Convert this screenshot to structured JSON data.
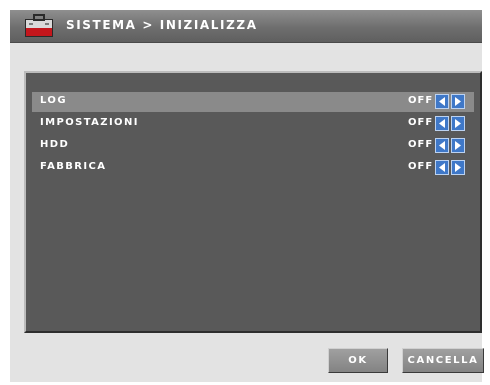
{
  "window": {
    "title": "SISTEMA > INIZIALIZZA"
  },
  "settings": {
    "rows": [
      {
        "label": "LOG",
        "value": "OFF"
      },
      {
        "label": "IMPOSTAZIONI",
        "value": "OFF"
      },
      {
        "label": "HDD",
        "value": "OFF"
      },
      {
        "label": "FABBRICA",
        "value": "OFF"
      }
    ]
  },
  "buttons": {
    "ok_label": "OK",
    "cancel_label": "CANCELLA"
  },
  "icons": {
    "title": "system-toolbox-icon",
    "prev": "arrow-left-icon",
    "next": "arrow-right-icon"
  },
  "colors": {
    "titlebar": "#6e6e6e",
    "panel": "#595959",
    "selected_row": "#8a8a8a",
    "arrow_button": "#3f78c8"
  }
}
